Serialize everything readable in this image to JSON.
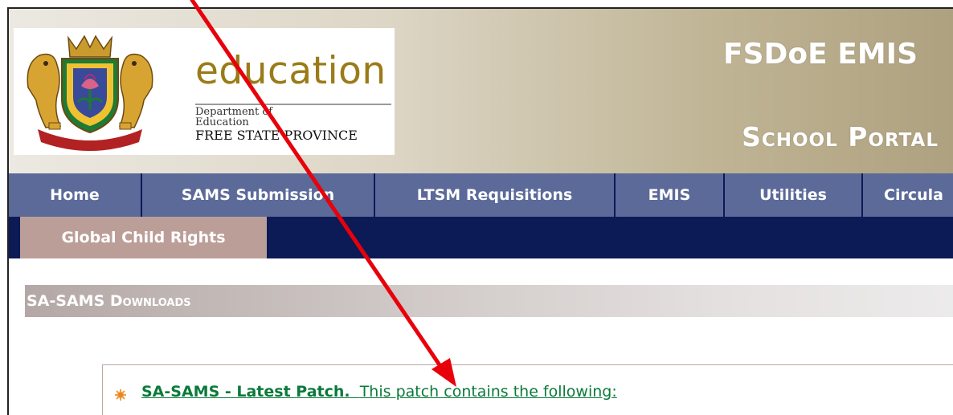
{
  "header": {
    "logo": {
      "word": "education",
      "dept_line1": "Department of",
      "dept_line2": "Education",
      "province": "FREE STATE PROVINCE",
      "crest_icon": "coat-of-arms-icon"
    },
    "portal_title_1": "FSDoE EMIS",
    "portal_title_2": "School Portal"
  },
  "nav": {
    "row1": [
      "Home",
      "SAMS Submission",
      "LTSM Requisitions",
      "EMIS",
      "Utilities",
      "Circula"
    ],
    "row2": [
      "Global Child Rights"
    ]
  },
  "section": {
    "title": "SA-SAMS Downloads"
  },
  "downloads": {
    "items": [
      {
        "bold_text": "SA-SAMS - Latest Patch.",
        "text": "This patch contains the following:"
      }
    ]
  },
  "colors": {
    "nav_bg": "#0c1a55",
    "nav_item": "#5b6a99",
    "nav_item_active": "#bc9e98",
    "link": "#0b7a3a",
    "annotation_arrow": "#e8000b",
    "education_gold": "#9a7b18"
  }
}
